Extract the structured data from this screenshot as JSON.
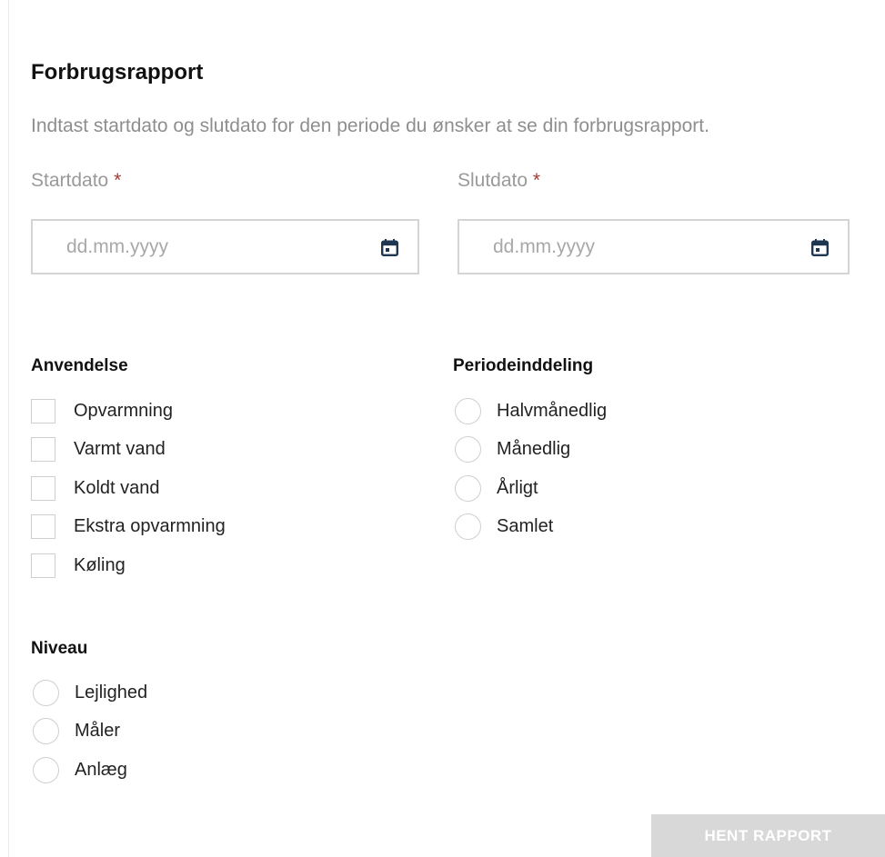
{
  "form": {
    "title": "Forbrugsrapport",
    "description": "Indtast startdato og slutdato for den periode du ønsker at se din forbrugsrapport.",
    "required_marker": "*",
    "start_date": {
      "label": "Startdato",
      "placeholder": "dd.mm.yyyy",
      "value": ""
    },
    "end_date": {
      "label": "Slutdato",
      "placeholder": "dd.mm.yyyy",
      "value": ""
    }
  },
  "anvendelse": {
    "heading": "Anvendelse",
    "options": [
      {
        "label": "Opvarmning",
        "checked": false
      },
      {
        "label": "Varmt vand",
        "checked": false
      },
      {
        "label": "Koldt vand",
        "checked": false
      },
      {
        "label": "Ekstra opvarmning",
        "checked": false
      },
      {
        "label": "Køling",
        "checked": false
      }
    ]
  },
  "periodeinddeling": {
    "heading": "Periodeinddeling",
    "options": [
      {
        "label": "Halvmånedlig",
        "selected": false
      },
      {
        "label": "Månedlig",
        "selected": false
      },
      {
        "label": "Årligt",
        "selected": false
      },
      {
        "label": "Samlet",
        "selected": false
      }
    ]
  },
  "niveau": {
    "heading": "Niveau",
    "options": [
      {
        "label": "Lejlighed",
        "selected": false
      },
      {
        "label": "Måler",
        "selected": false
      },
      {
        "label": "Anlæg",
        "selected": false
      }
    ]
  },
  "submit": {
    "label": "HENT RAPPORT",
    "enabled": false
  },
  "colors": {
    "required": "#a23b32",
    "icon": "#1f3650",
    "button_disabled": "#d8d8d8"
  },
  "icons": {
    "date_picker": "calendar-icon"
  }
}
